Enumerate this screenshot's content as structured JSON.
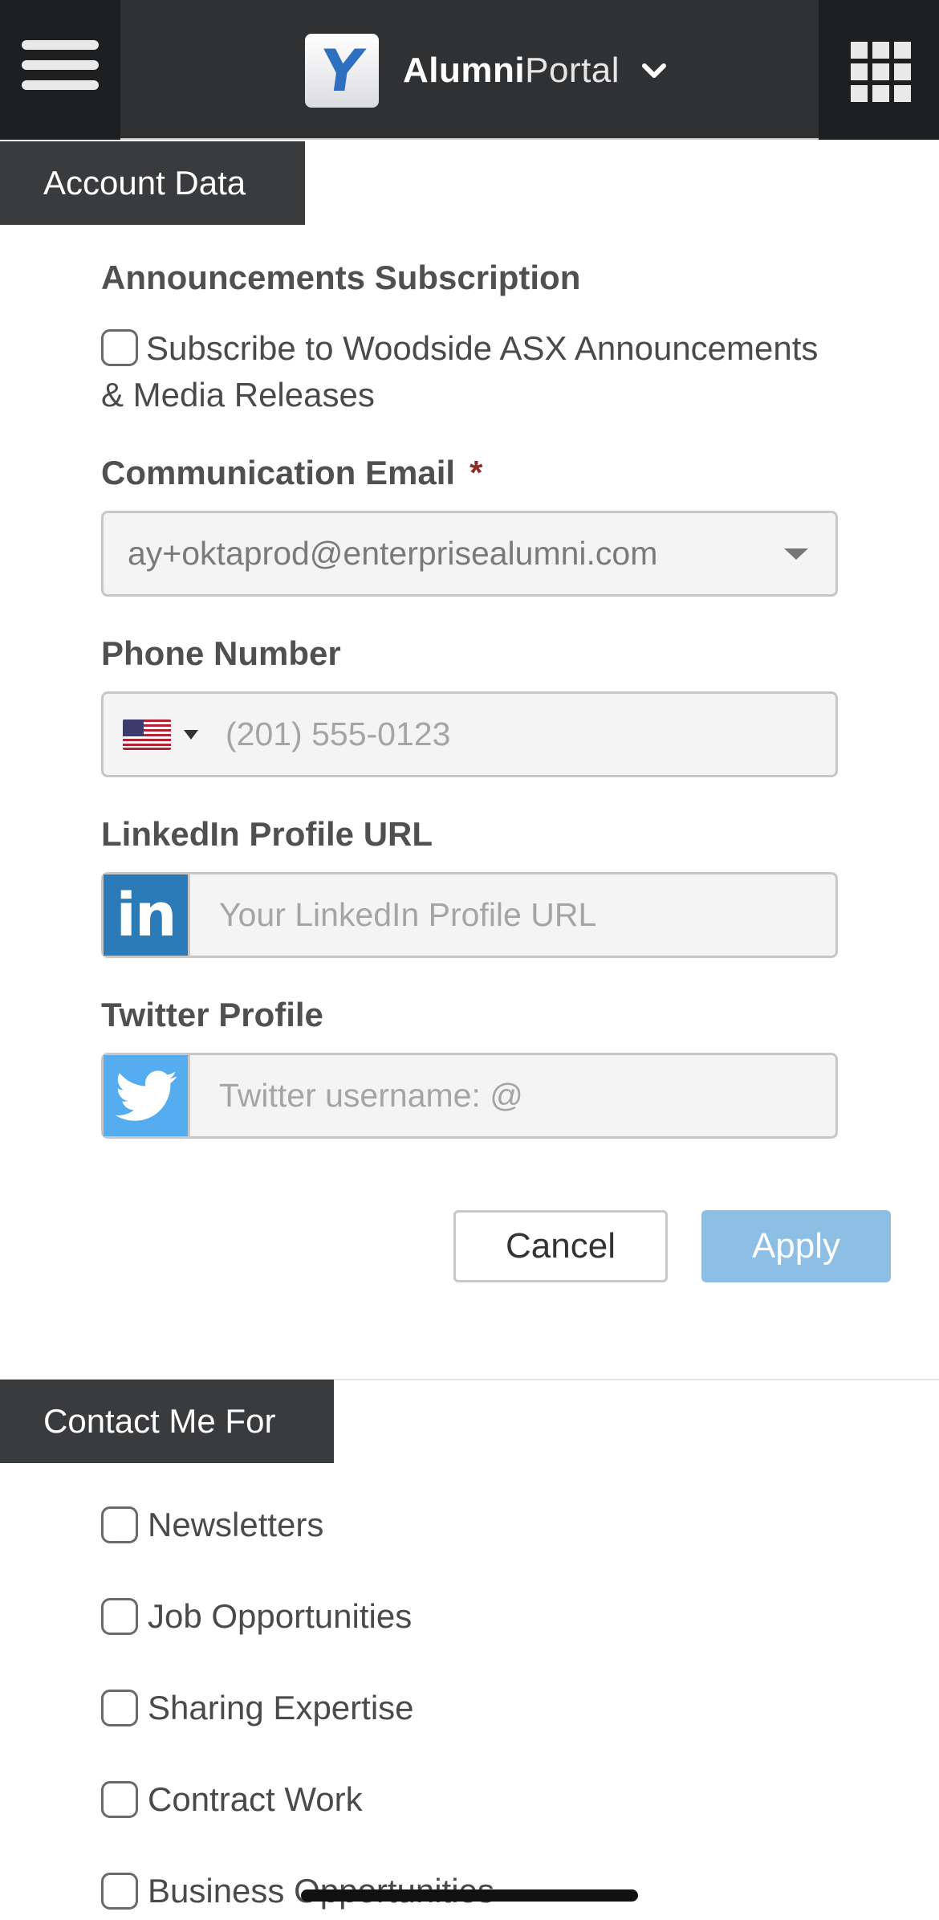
{
  "header": {
    "brand_bold": "Alumni",
    "brand_light": "Portal",
    "logo_letter": "Y",
    "menu_icon": "hamburger-icon",
    "apps_icon": "grid-icon"
  },
  "account_section": {
    "title": "Account Data",
    "announcements_label": "Announcements Subscription",
    "subscribe_text": "Subscribe to Woodside ASX Announcements & Media Releases",
    "comm_email_label": "Communication Email",
    "required_mark": "*",
    "comm_email_value": "ay+oktaprod@enterprisealumni.com",
    "phone_label": "Phone Number",
    "phone_placeholder": "(201) 555-0123",
    "linkedin_label": "LinkedIn Profile URL",
    "linkedin_icon_text": "in",
    "linkedin_placeholder": "Your LinkedIn Profile URL",
    "twitter_label": "Twitter Profile",
    "twitter_placeholder": "Twitter username: @",
    "cancel_label": "Cancel",
    "apply_label": "Apply"
  },
  "contact_section": {
    "title": "Contact Me For",
    "options": [
      "Newsletters",
      "Job Opportunities",
      "Sharing Expertise",
      "Contract Work",
      "Business Opportunities"
    ]
  },
  "colors": {
    "topbar": "#303133",
    "section_tab": "#3a3b3d",
    "apply_button": "#8cbfe3",
    "linkedin": "#2b7bb9",
    "twitter": "#55acee",
    "required": "#8b2b2b"
  }
}
